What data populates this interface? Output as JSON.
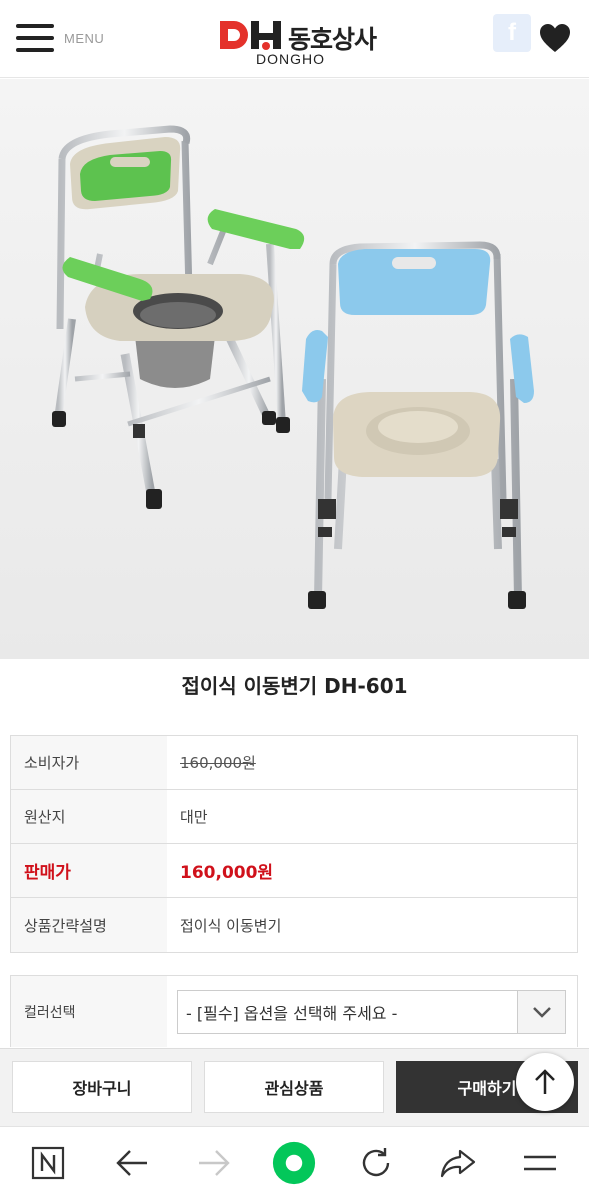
{
  "header": {
    "menu_label": "MENU",
    "logo_text_kr": "동호상사",
    "logo_text_en": "DONGHO",
    "facebook_label": "f"
  },
  "product": {
    "title": "접이식 이동변기 DH-601",
    "image_alt": "접이식 이동변기"
  },
  "info": {
    "rows": [
      {
        "label": "소비자가",
        "value": "160,000원"
      },
      {
        "label": "원산지",
        "value": "대만"
      },
      {
        "label": "판매가",
        "value": "160,000원"
      },
      {
        "label": "상품간략설명",
        "value": "접이식 이동변기"
      }
    ]
  },
  "option": {
    "label": "컬러선택",
    "selected": "- [필수] 옵션을 선택해 주세요 -"
  },
  "actions": {
    "cart": "장바구니",
    "wishlist": "관심상품",
    "buy": "구매하기"
  },
  "colors": {
    "sale_red": "#d0111b",
    "logo_red": "#e4322b",
    "chair_green": "#6ccf5a",
    "chair_blue": "#8cc9ec",
    "buy_button": "#333333",
    "naver_green": "#03c75a"
  },
  "icons": {
    "menu": "hamburger-icon",
    "facebook": "facebook-icon",
    "wishlist": "heart-icon",
    "select": "chevron-down-icon",
    "scroll_top": "arrow-up-icon",
    "nav": [
      "naver-n-icon",
      "back-arrow-icon",
      "forward-arrow-icon",
      "green-dot-icon",
      "refresh-icon",
      "share-icon",
      "menu-lines-icon"
    ]
  }
}
